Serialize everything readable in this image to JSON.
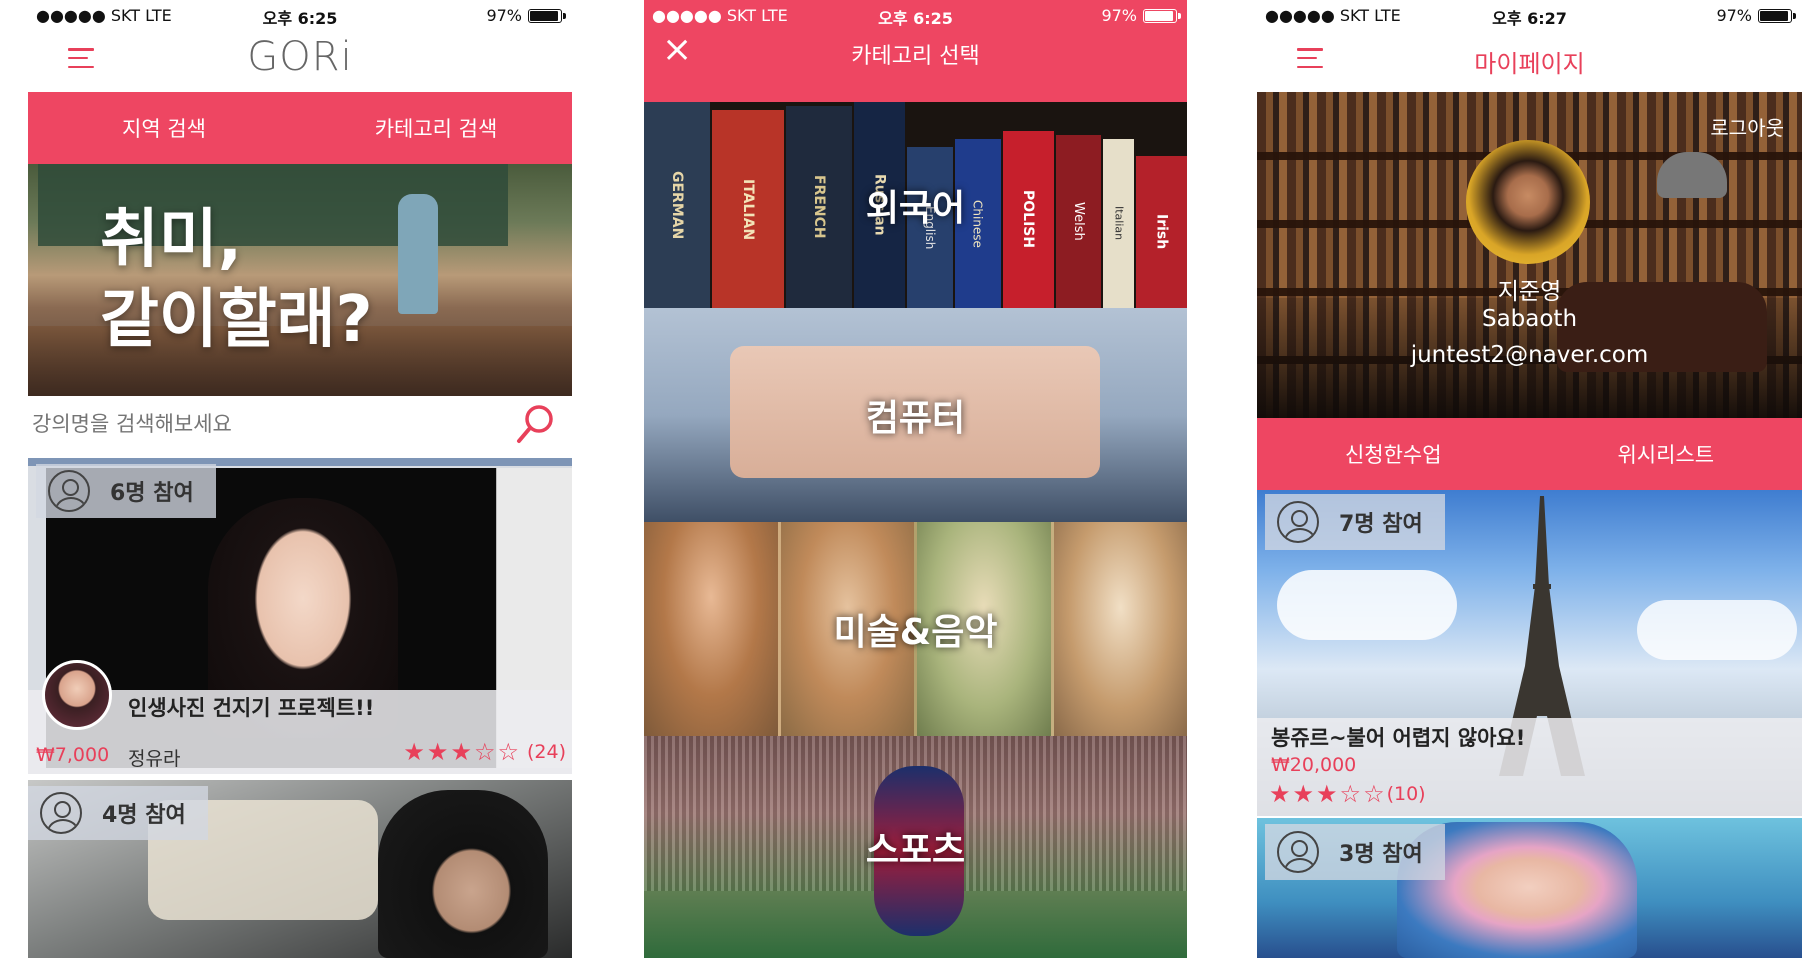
{
  "screens": [
    {
      "status": {
        "carrier": "●●●●● SKT   LTE",
        "time": "오후 6:25",
        "battery": "97%"
      },
      "logo": "GORi",
      "tabs": [
        "지역 검색",
        "카테고리 검색"
      ],
      "hero": {
        "line1": "취미,",
        "line2": "같이할래?"
      },
      "search": {
        "placeholder": "강의명을 검색해보세요"
      },
      "cards": [
        {
          "participants": "6명 참여",
          "title": "인생사진 건지기 프로젝트!!",
          "price": "₩7,000",
          "teacher": "정유라",
          "rating": "★★★☆☆",
          "reviews": "(24)"
        },
        {
          "participants": "4명 참여"
        }
      ]
    },
    {
      "status": {
        "carrier": "●●●●● SKT   LTE",
        "time": "오후 6:25",
        "battery": "97%"
      },
      "title": "카테고리 선택",
      "close_icon": "×",
      "categories": [
        "외국어",
        "컴퓨터",
        "미술&음악",
        "스포츠"
      ],
      "book_titles": [
        "GERMAN",
        "ITALIAN",
        "FRENCH",
        "Russian",
        "English",
        "Chinese",
        "POLISH",
        "Welsh",
        "Italian",
        "Irish"
      ]
    },
    {
      "status": {
        "carrier": "●●●●● SKT   LTE",
        "time": "오후 6:27",
        "battery": "97%"
      },
      "title": "마이페이지",
      "logout": "로그아웃",
      "profile": {
        "name": "지준영",
        "nickname": "Sabaoth",
        "email": "juntest2@naver.com"
      },
      "tabs": [
        "신청한수업",
        "위시리스트"
      ],
      "cards": [
        {
          "participants": "7명 참여",
          "title": "봉쥬르~불어 어렵지 않아요!",
          "price": "₩20,000",
          "rating": "★★★☆☆",
          "reviews": "(10)"
        },
        {
          "participants": "3명 참여"
        }
      ]
    }
  ]
}
